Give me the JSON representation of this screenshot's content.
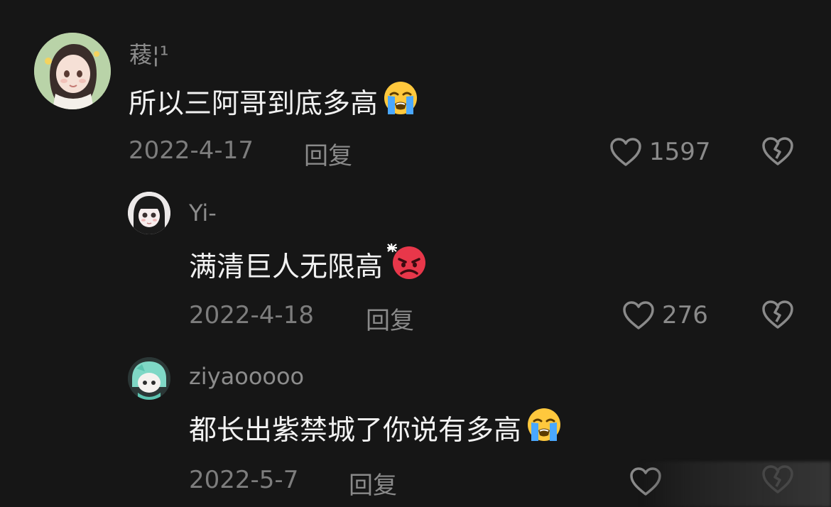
{
  "comments": [
    {
      "username": "薐¦¹",
      "text": "所以三阿哥到底多高",
      "emoji": "loudly-crying-face",
      "date": "2022-4-17",
      "reply_label": "回复",
      "likes": "1597"
    },
    {
      "username": "Yi-",
      "text": "满清巨人无限高",
      "emoji": "angry-face-with-symbols",
      "date": "2022-4-18",
      "reply_label": "回复",
      "likes": "276"
    },
    {
      "username": "ziyaooooo",
      "text": "都长出紫禁城了你说有多高",
      "emoji": "loudly-crying-face",
      "date": "2022-5-7",
      "reply_label": "回复",
      "likes": ""
    }
  ],
  "colors": {
    "background": "#161616",
    "text": "#f2f2f2",
    "muted": "#7d7d7d",
    "emoji_yellow": "#ffc83d",
    "emoji_red": "#e8374a",
    "tear_blue": "#4aa8ff"
  }
}
